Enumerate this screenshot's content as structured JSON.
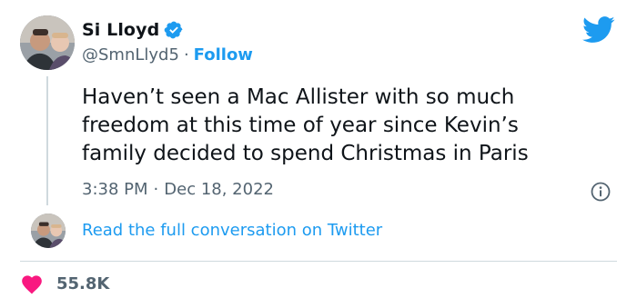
{
  "author": {
    "display_name": "Si Lloyd",
    "handle": "@SmnLlyd5",
    "separator": "·",
    "follow_label": "Follow",
    "verified": true
  },
  "tweet": {
    "lines": [
      "Haven’t seen a Mac Allister with so much",
      "freedom at this time of year since Kevin’s",
      "family decided to spend Christmas in Paris"
    ],
    "time": "3:38 PM",
    "separator": "·",
    "date": "Dec 18, 2022"
  },
  "conversation": {
    "link_label": "Read the full conversation on Twitter"
  },
  "engagement": {
    "likes": "55.8K"
  },
  "colors": {
    "accent": "#1d9bf0",
    "heart": "#f91880",
    "text_secondary": "#536471",
    "divider": "#cfd9de"
  },
  "icons": {
    "verified": "verified-badge-icon",
    "brand": "twitter-bird-icon",
    "info": "info-icon",
    "like": "heart-icon"
  }
}
